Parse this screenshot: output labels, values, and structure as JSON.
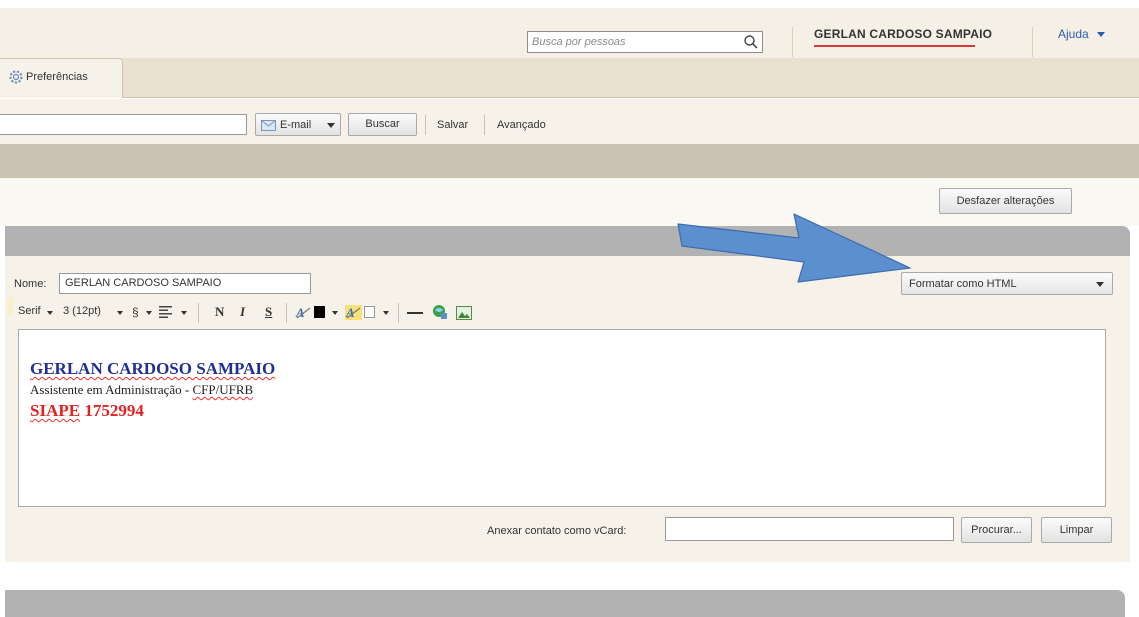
{
  "header": {
    "search_placeholder": "Busca por pessoas",
    "username": "GERLAN CARDOSO SAMPAIO",
    "help_label": "Ajuda"
  },
  "tabs": {
    "preferences_label": "Preferências"
  },
  "toolbar": {
    "email_label": "E-mail",
    "search_button": "Buscar",
    "save_label": "Salvar",
    "advanced_label": "Avançado"
  },
  "actions": {
    "undo_label": "Desfazer alterações"
  },
  "signature_form": {
    "name_label": "Nome:",
    "name_value": "GERLAN CARDOSO SAMPAIO",
    "format_select": "Formatar como HTML",
    "font_family": "Serif",
    "font_size": "3 (12pt)",
    "bold_label": "N",
    "italic_label": "I",
    "underline_label": "S"
  },
  "signature": {
    "name": "GERLAN CARDOSO SAMPAIO",
    "role_prefix": "Assistente em Administração - ",
    "role_org": "CFP/UFRB",
    "siape_prefix": "SIAPE",
    "siape_number": " 1752994",
    "name_color": "#1f2f96",
    "siape_color": "#e52121"
  },
  "vcard": {
    "label": "Anexar contato como vCard:",
    "browse_button": "Procurar...",
    "clear_button": "Limpar"
  },
  "annotation": {
    "arrow_color": "#5b8fd0",
    "arrow_icon": "blue-arrow-pointing-right"
  }
}
